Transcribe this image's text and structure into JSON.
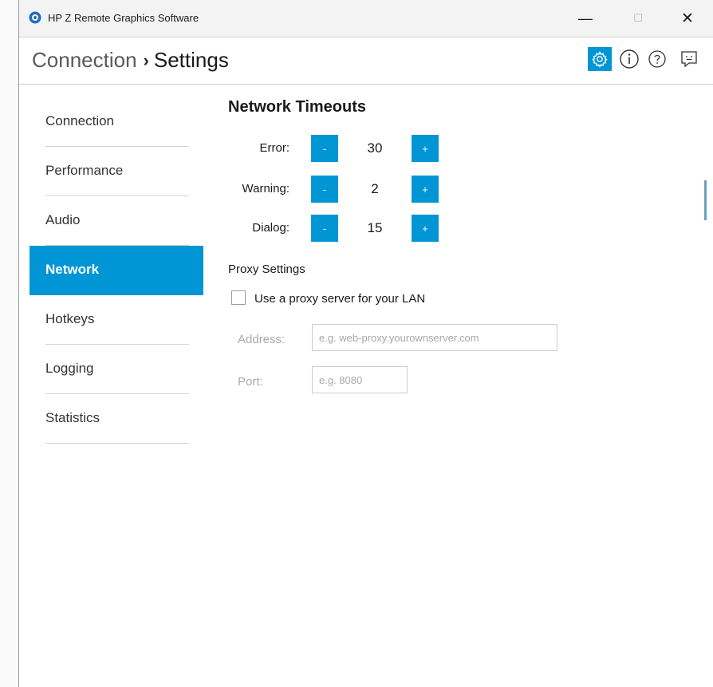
{
  "window": {
    "title": "HP Z Remote Graphics Software",
    "minimize_glyph": "—",
    "maximize_glyph": "☐",
    "close_glyph": "✕"
  },
  "header": {
    "breadcrumb_parent": "Connection",
    "breadcrumb_separator": "›",
    "breadcrumb_current": "Settings",
    "icons": [
      "settings-gear-icon",
      "info-icon",
      "help-icon",
      "feedback-icon"
    ]
  },
  "sidebar": {
    "items": [
      {
        "label": "Connection",
        "active": false
      },
      {
        "label": "Performance",
        "active": false
      },
      {
        "label": "Audio",
        "active": false
      },
      {
        "label": "Network",
        "active": true
      },
      {
        "label": "Hotkeys",
        "active": false
      },
      {
        "label": "Logging",
        "active": false
      },
      {
        "label": "Statistics",
        "active": false
      }
    ]
  },
  "network": {
    "section_title": "Network Timeouts",
    "timeouts": [
      {
        "label": "Error:",
        "value": "30",
        "minus": "-",
        "plus": "+"
      },
      {
        "label": "Warning:",
        "value": "2",
        "minus": "-",
        "plus": "+"
      },
      {
        "label": "Dialog:",
        "value": "15",
        "minus": "-",
        "plus": "+"
      }
    ],
    "proxy": {
      "title": "Proxy Settings",
      "checkbox_label": "Use a proxy server for your LAN",
      "checked": false,
      "address_label": "Address:",
      "address_placeholder": "e.g. web-proxy.yourownserver.com",
      "port_label": "Port:",
      "port_placeholder": "e.g. 8080"
    }
  },
  "colors": {
    "accent": "#0096d6",
    "active_nav_text": "#ffffff",
    "disabled_text": "#a8a8a8"
  }
}
